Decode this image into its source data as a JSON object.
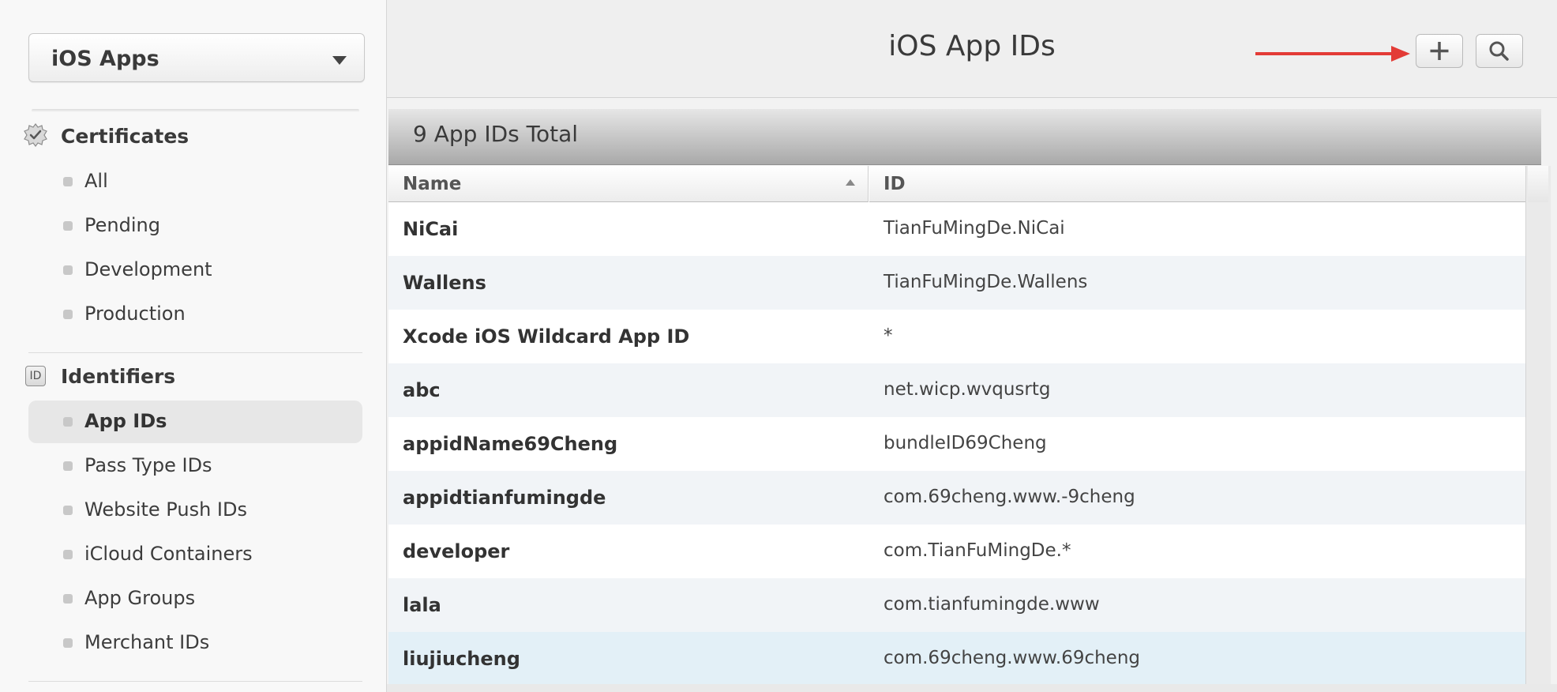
{
  "sidebar": {
    "platform_select": "iOS Apps",
    "sections": [
      {
        "title": "Certificates",
        "icon": "certificate-seal-icon",
        "items": [
          {
            "label": "All"
          },
          {
            "label": "Pending"
          },
          {
            "label": "Development"
          },
          {
            "label": "Production"
          }
        ]
      },
      {
        "title": "Identifiers",
        "icon": "id-badge-icon",
        "icon_text": "ID",
        "items": [
          {
            "label": "App IDs",
            "selected": true
          },
          {
            "label": "Pass Type IDs"
          },
          {
            "label": "Website Push IDs"
          },
          {
            "label": "iCloud Containers"
          },
          {
            "label": "App Groups"
          },
          {
            "label": "Merchant IDs"
          }
        ]
      }
    ]
  },
  "header": {
    "title": "iOS App IDs",
    "add_icon": "plus-icon",
    "search_icon": "search-icon",
    "annotation_arrow_color": "#e33b36"
  },
  "summary": {
    "total": "9 App IDs Total"
  },
  "table": {
    "columns": [
      "Name",
      "ID"
    ],
    "rows": [
      {
        "name": "NiCai",
        "id": "TianFuMingDe.NiCai",
        "bg": "#ffffff"
      },
      {
        "name": "Wallens",
        "id": "TianFuMingDe.Wallens",
        "bg": "#f1f4f7"
      },
      {
        "name": "Xcode iOS Wildcard App ID",
        "id": "*",
        "bg": "#ffffff"
      },
      {
        "name": "abc",
        "id": "net.wicp.wvqusrtg",
        "bg": "#f1f4f7"
      },
      {
        "name": "appidName69Cheng",
        "id": "bundleID69Cheng",
        "bg": "#ffffff"
      },
      {
        "name": "appidtianfumingde",
        "id": "com.69cheng.www.-9cheng",
        "bg": "#f1f4f7"
      },
      {
        "name": "developer",
        "id": "com.TianFuMingDe.*",
        "bg": "#ffffff"
      },
      {
        "name": "lala",
        "id": "com.tianfumingde.www",
        "bg": "#f1f4f7"
      },
      {
        "name": "liujiucheng",
        "id": "com.69cheng.www.69cheng",
        "bg": "#e3f0f7"
      }
    ]
  }
}
